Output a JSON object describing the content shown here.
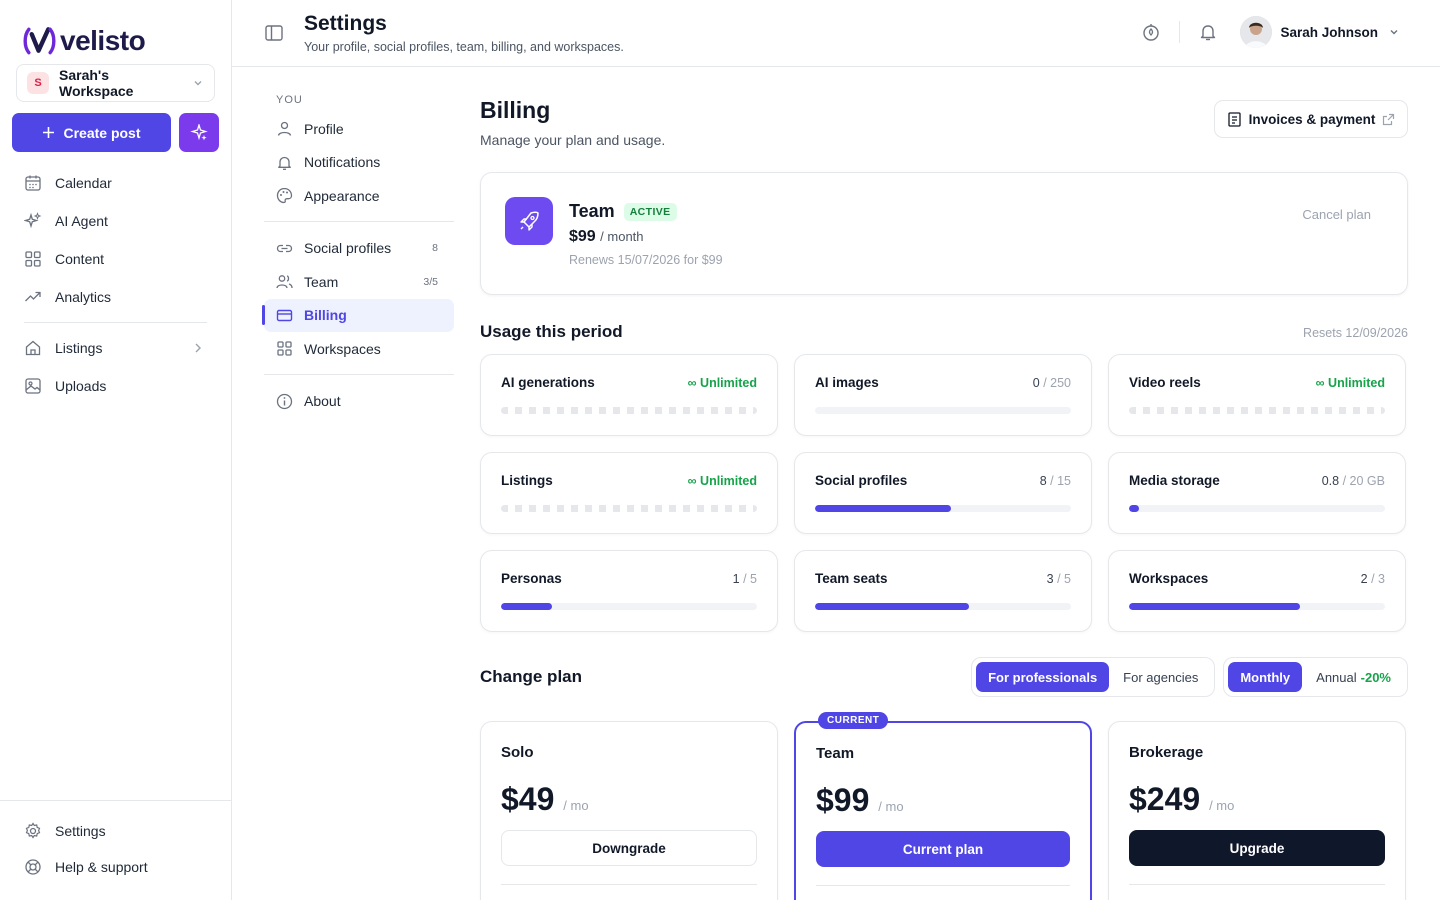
{
  "brand": {
    "name": "velisto",
    "accent": "#4f46e5",
    "secondary": "#7c3aed"
  },
  "workspace": {
    "initial": "S",
    "name": "Sarah's Workspace"
  },
  "sidebar": {
    "create_label": "Create post",
    "items": [
      {
        "label": "Calendar",
        "icon": "calendar-icon"
      },
      {
        "label": "AI Agent",
        "icon": "sparkle-icon"
      },
      {
        "label": "Content",
        "icon": "grid-icon"
      },
      {
        "label": "Analytics",
        "icon": "trend-icon"
      }
    ],
    "items2": [
      {
        "label": "Listings",
        "icon": "home-icon"
      },
      {
        "label": "Uploads",
        "icon": "image-icon"
      }
    ],
    "bottom": [
      {
        "label": "Settings",
        "icon": "gear-icon"
      },
      {
        "label": "Help & support",
        "icon": "lifebuoy-icon"
      }
    ]
  },
  "header": {
    "title": "Settings",
    "subtitle": "Your profile, social profiles, team, billing, and workspaces.",
    "user_name": "Sarah Johnson"
  },
  "settings_nav": {
    "section_label": "YOU",
    "group1": [
      {
        "label": "Profile"
      },
      {
        "label": "Notifications"
      },
      {
        "label": "Appearance"
      }
    ],
    "group2": [
      {
        "label": "Social profiles",
        "count": "8"
      },
      {
        "label": "Team",
        "count": "3/5"
      },
      {
        "label": "Billing",
        "active": true
      },
      {
        "label": "Workspaces"
      }
    ],
    "about": "About"
  },
  "billing": {
    "title": "Billing",
    "subtitle": "Manage your plan and usage.",
    "invoices_label": "Invoices & payment",
    "plan": {
      "name": "Team",
      "status": "ACTIVE",
      "price": "$99",
      "period": "/ month",
      "renews": "Renews 15/07/2026 for $99",
      "cancel_label": "Cancel plan"
    },
    "usage": {
      "title": "Usage this period",
      "resets": "Resets 12/09/2026",
      "cards": [
        {
          "label": "AI generations",
          "unlimited": true,
          "unlimited_text": "∞ Unlimited"
        },
        {
          "label": "AI images",
          "used": "0",
          "limit": "/ 250",
          "fraction": 0
        },
        {
          "label": "Video reels",
          "unlimited": true,
          "unlimited_text": "∞ Unlimited"
        },
        {
          "label": "Listings",
          "unlimited": true,
          "unlimited_text": "∞ Unlimited"
        },
        {
          "label": "Social profiles",
          "used": "8",
          "limit": "/ 15",
          "fraction": 0.533
        },
        {
          "label": "Media storage",
          "used": "0.8",
          "limit": "/ 20 GB",
          "fraction": 0.04
        },
        {
          "label": "Personas",
          "used": "1",
          "limit": "/ 5",
          "fraction": 0.2
        },
        {
          "label": "Team seats",
          "used": "3",
          "limit": "/ 5",
          "fraction": 0.6
        },
        {
          "label": "Workspaces",
          "used": "2",
          "limit": "/ 3",
          "fraction": 0.667
        }
      ]
    },
    "change_plan": {
      "title": "Change plan",
      "audience_options": [
        "For professionals",
        "For agencies"
      ],
      "audience_selected": "For professionals",
      "cycle_options": [
        "Monthly",
        "Annual"
      ],
      "cycle_selected": "Monthly",
      "annual_discount": "-20%",
      "plans": [
        {
          "name": "Solo",
          "price": "$49",
          "unit": "/ mo",
          "button": "Downgrade",
          "style": "outline"
        },
        {
          "name": "Team",
          "price": "$99",
          "unit": "/ mo",
          "button": "Current plan",
          "style": "primary",
          "badge": "CURRENT"
        },
        {
          "name": "Brokerage",
          "price": "$249",
          "unit": "/ mo",
          "button": "Upgrade",
          "style": "dark"
        }
      ]
    }
  }
}
